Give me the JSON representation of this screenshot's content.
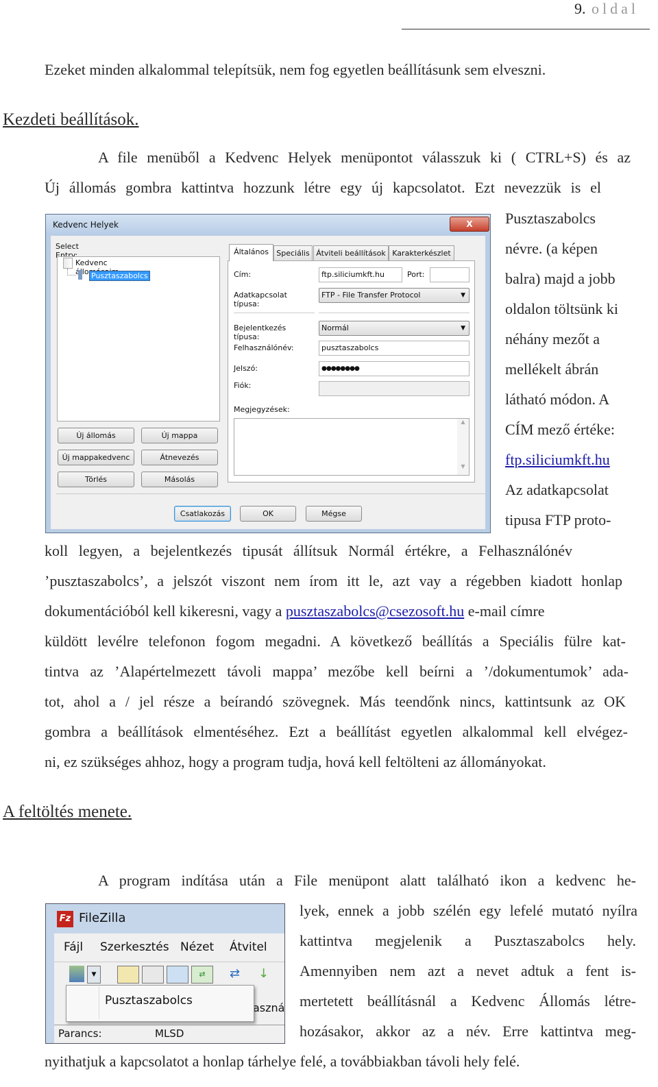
{
  "header": {
    "page_number": "9.",
    "page_word": "oldal"
  },
  "intro": "Ezeket minden alkalommal telepítsük, nem fog egyetlen beállításunk sem elveszni.",
  "section1": {
    "heading": "Kezdeti beállítások.",
    "lines": [
      "A file menüből a Kedvenc Helyek menüpontot válasszuk ki ( CTRL+S) és az",
      "Új állomás gombra kattintva hozzunk létre egy új kapcsolatot. Ezt nevezzük is el"
    ],
    "side_lines": [
      "Pusztaszabolcs",
      "névre. (a képen",
      "balra) majd a jobb",
      "oldalon töltsünk ki",
      "néhány mezőt a",
      "mellékelt ábrán",
      "látható módon. A",
      "CÍM mező értéke:",
      "ftp.siliciumkft.hu",
      "Az adatkapcsolat",
      "tipusa FTP proto-"
    ],
    "after_lines": [
      "koll legyen, a bejelentkezés tipusát állítsuk Normál értékre, a Felhasználónév",
      "’pusztaszabolcs’, a jelszót viszont nem írom itt le, azt vay a régebben kiadott honlap",
      "dokumentációból kell kikeresni, vagy a ",
      "pusztaszabolcs@csezosoft.hu",
      " e-mail címre",
      "küldött levélre telefonon fogom megadni. A következő beállítás a Speciális fülre kat-",
      "tintva az ’Alapértelmezett távoli mappa’ mezőbe kell beírni a ’/dokumentumok’ ada-",
      "tot, ahol a / jel része a beírandó szövegnek. Más teendőnk nincs, kattintsunk az OK",
      "gombra  a beállítások elmentéséhez. Ezt a beállítást egyetlen alkalommal kell elvégez-",
      "ni, ez szükséges ahhoz, hogy a program tudja, hová kell feltölteni az állományokat."
    ]
  },
  "dialog": {
    "title": "Kedvenc Helyek",
    "close": "X",
    "select_entry": "Select Entry:",
    "tree": {
      "folder": "Kedvenc állomásaim",
      "site": "Pusztaszabolcs"
    },
    "left_buttons": [
      "Új állomás",
      "Új mappa",
      "Új mappakedvenc",
      "Átnevezés",
      "Törlés",
      "Másolás"
    ],
    "tabs": [
      "Általános",
      "Speciális",
      "Átviteli beállítások",
      "Karakterkészlet"
    ],
    "active_tab": "Általános",
    "fields": {
      "host_label": "Cím:",
      "host_value": "ftp.siliciumkft.hu",
      "port_label": "Port:",
      "port_value": "",
      "protocol_label": "Adatkapcsolat típusa:",
      "protocol_value": "FTP - File Transfer Protocol",
      "logon_label": "Bejelentkezés típusa:",
      "logon_value": "Normál",
      "user_label": "Felhasználónév:",
      "user_value": "pusztaszabolcs",
      "password_label": "Jelszó:",
      "password_value": "●●●●●●●●",
      "account_label": "Fiók:",
      "account_value": "",
      "comments_label": "Megjegyzések:"
    },
    "bottom_buttons": [
      "Csatlakozás",
      "OK",
      "Mégse"
    ]
  },
  "section2": {
    "heading": "A feltöltés menete.",
    "first_line": "A program indítása után a File menüpont alatt található ikon a kedvenc he-",
    "side_lines": [
      "lyek, ennek a jobb szélén egy lefelé mutató nyílra",
      "kattintva megjelenik a Pusztaszabolcs hely.",
      "Amennyiben nem azt a nevet adtuk a fent is-",
      "mertetett beállításnál a Kedvenc Állomás létre-",
      "hozásakor, akkor az a név. Erre kattintva meg-"
    ],
    "last_line": "nyithatjuk a kapcsolatot a honlap tárhelye felé, a továbbiakban távoli hely felé."
  },
  "filezilla": {
    "title": "FileZilla",
    "logo": "Fz",
    "menu": [
      "Fájl",
      "Szerkesztés",
      "Nézet",
      "Átvitel"
    ],
    "dropdown_item": "Pusztaszabolcs",
    "partial_text": "asznál",
    "status_label": "Parancs:",
    "status_value": "MLSD"
  }
}
